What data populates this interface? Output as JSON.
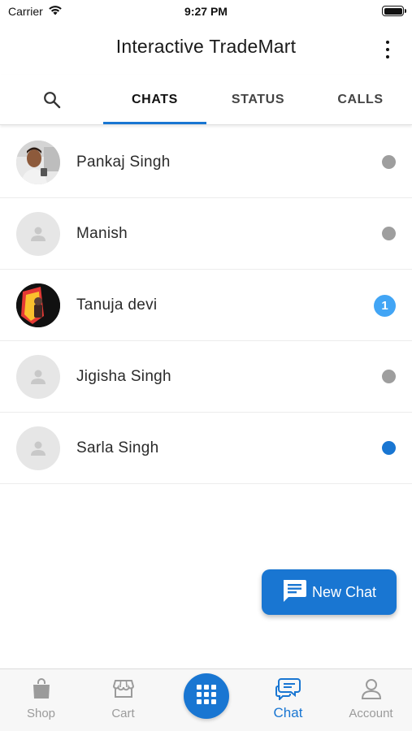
{
  "status_bar": {
    "carrier": "Carrier",
    "time": "9:27 PM"
  },
  "header": {
    "title": "Interactive TradeMart"
  },
  "tabs": [
    {
      "label": "CHATS",
      "active": true
    },
    {
      "label": "STATUS",
      "active": false
    },
    {
      "label": "CALLS",
      "active": false
    }
  ],
  "chats": [
    {
      "name": "Pankaj Singh",
      "avatar": "photo",
      "indicator": "dot",
      "indicator_color": "#9e9e9e"
    },
    {
      "name": "Manish",
      "avatar": "placeholder",
      "indicator": "dot",
      "indicator_color": "#9e9e9e"
    },
    {
      "name": "Tanuja devi",
      "avatar": "photo",
      "indicator": "badge",
      "unread_count": "1",
      "indicator_color": "#42a5f5"
    },
    {
      "name": "Jigisha Singh",
      "avatar": "placeholder",
      "indicator": "dot",
      "indicator_color": "#9e9e9e"
    },
    {
      "name": "Sarla Singh",
      "avatar": "placeholder",
      "indicator": "dot",
      "indicator_color": "#1976d2"
    }
  ],
  "fab": {
    "label": "New Chat"
  },
  "bottom_nav": [
    {
      "label": "Shop",
      "icon": "shopping-bag-icon",
      "active": false
    },
    {
      "label": "Cart",
      "icon": "storefront-icon",
      "active": false
    },
    {
      "label": "Chat",
      "icon": "chat-bubbles-icon",
      "active": true
    },
    {
      "label": "Account",
      "icon": "person-icon",
      "active": false
    }
  ],
  "colors": {
    "accent": "#1976d2",
    "badge": "#42a5f5",
    "inactive_dot": "#9e9e9e"
  }
}
